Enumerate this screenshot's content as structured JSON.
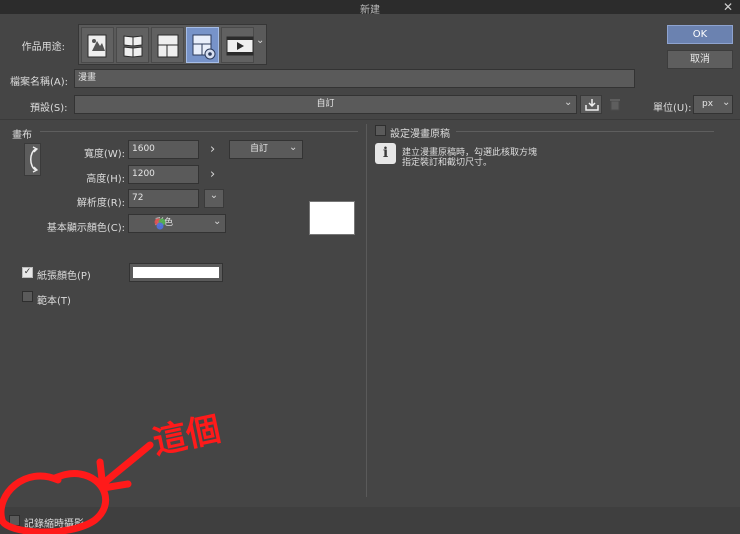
{
  "window": {
    "title": "新建",
    "close_glyph": "✕"
  },
  "dialog": {
    "ok_label": "OK",
    "cancel_label": "取消"
  },
  "usage": {
    "label": "作品用途:",
    "buttons": [
      {
        "name": "illustration-icon"
      },
      {
        "name": "webtoon-icon"
      },
      {
        "name": "comic-page-icon"
      },
      {
        "name": "comic-settings-icon",
        "selected": true
      },
      {
        "name": "animation-icon"
      }
    ],
    "more_glyph": "⌄"
  },
  "filename": {
    "label": "檔案名稱(A):",
    "value": "漫畫"
  },
  "preset": {
    "label": "預設(S):",
    "value": "自訂"
  },
  "unit": {
    "label": "單位(U):",
    "value": "px"
  },
  "canvas": {
    "section_label": "畫布",
    "width_label": "寬度(W):",
    "width_value": "1600",
    "height_label": "高度(H):",
    "height_value": "1200",
    "size_preset": "自訂",
    "resolution_label": "解析度(R):",
    "resolution_value": "72",
    "color_label": "基本顯示顏色(C):",
    "color_value": "彩色",
    "paper_color_label": "紙張顏色(P)",
    "paper_color": "#ffffff",
    "template_label": "範本(T)",
    "arrow": "›"
  },
  "manuscript": {
    "label": "設定漫畫原稿",
    "info_line1": "建立漫畫原稿時，勾選此核取方塊",
    "info_line2": "指定裝訂和截切尺寸。"
  },
  "bottom": {
    "timelapse_label": "記錄縮時攝影"
  },
  "annotation": {
    "text": "這個",
    "color": "#ff1a1a"
  }
}
